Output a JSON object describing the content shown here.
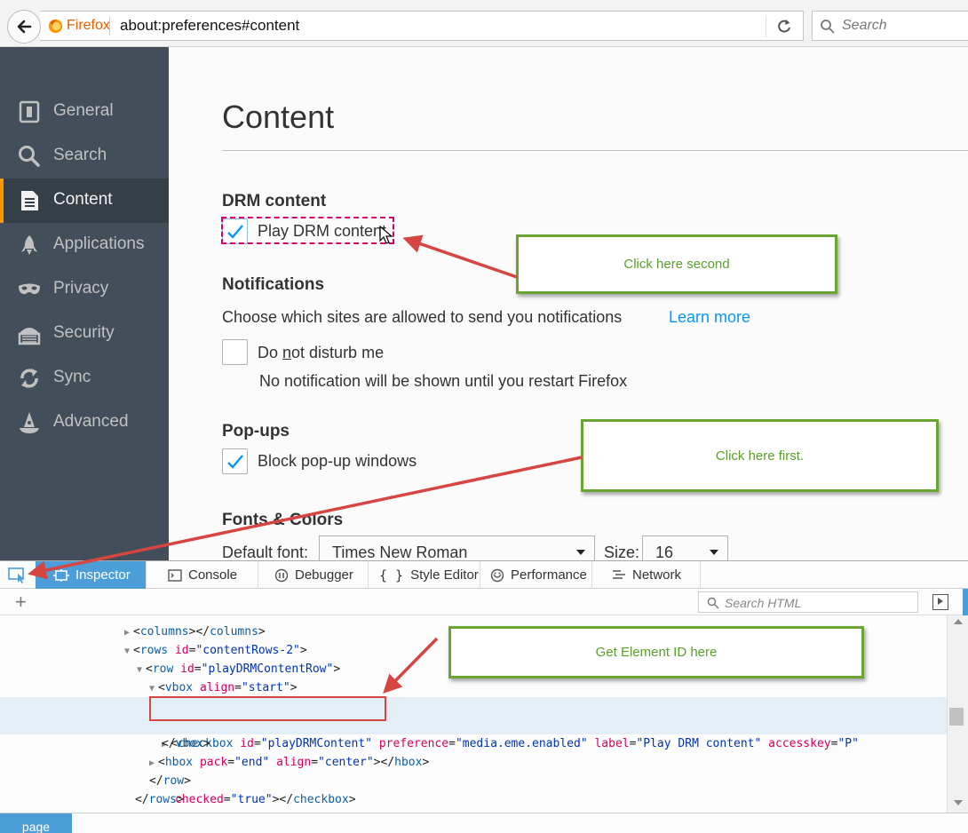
{
  "browser": {
    "brand": "Firefox",
    "url": "about:preferences#content",
    "search_placeholder": "Search"
  },
  "sidebar": {
    "items": [
      {
        "label": "General",
        "icon": "general-icon"
      },
      {
        "label": "Search",
        "icon": "search-icon"
      },
      {
        "label": "Content",
        "icon": "content-icon",
        "active": true
      },
      {
        "label": "Applications",
        "icon": "applications-icon"
      },
      {
        "label": "Privacy",
        "icon": "privacy-mask-icon"
      },
      {
        "label": "Security",
        "icon": "security-icon"
      },
      {
        "label": "Sync",
        "icon": "sync-icon"
      },
      {
        "label": "Advanced",
        "icon": "advanced-wizard-icon"
      }
    ]
  },
  "content": {
    "title": "Content",
    "drm": {
      "heading": "DRM content",
      "checkbox_label": "Play DRM content",
      "checked": true
    },
    "notifications": {
      "heading": "Notifications",
      "description": "Choose which sites are allowed to send you notifications",
      "learn_more": "Learn more",
      "dnd_label": "Do not disturb me",
      "dnd_label_parts": [
        "Do ",
        "n",
        "ot disturb me"
      ],
      "dnd_checked": false,
      "dnd_note": "No notification will be shown until you restart Firefox"
    },
    "popups": {
      "heading": "Pop-ups",
      "checkbox_label": "Block pop-up windows",
      "checked": true
    },
    "fonts": {
      "heading": "Fonts & Colors",
      "default_font_label": "Default font:",
      "default_font_value": "Times New Roman",
      "size_label": "Size:",
      "size_value": "16"
    }
  },
  "devtools": {
    "tabs": [
      {
        "label": "Inspector",
        "icon": "inspector-icon",
        "active": true
      },
      {
        "label": "Console",
        "icon": "console-icon"
      },
      {
        "label": "Debugger",
        "icon": "debugger-icon"
      },
      {
        "label": "Style Editor",
        "icon": "style-editor-braces-icon"
      },
      {
        "label": "Performance",
        "icon": "performance-icon"
      },
      {
        "label": "Network",
        "icon": "network-icon"
      }
    ],
    "add_node": "+",
    "search_placeholder": "Search HTML",
    "breadcrumb": "page",
    "markup": {
      "columns": {
        "open": "<",
        "name": "columns",
        "close": "></",
        "end": ">"
      },
      "rows": {
        "open": "<",
        "name": "rows",
        "attr": "id",
        "eq": "=",
        "value": "\"contentRows-2\"",
        "end": ">"
      },
      "row": {
        "open": "<",
        "name": "row",
        "attr": "id",
        "eq": "=",
        "value": "\"playDRMContentRow\"",
        "end": ">"
      },
      "vbox": {
        "open": "<",
        "name": "vbox",
        "attr": "align",
        "eq": "=",
        "value": "\"start\"",
        "end": ">"
      },
      "checkbox": {
        "open": "<",
        "name": "checkbox",
        "id_attr": "id",
        "id_value": "\"playDRMContent\"",
        "pref_attr": "preference",
        "pref_value": "\"media.eme.enabled\"",
        "label_attr": "label",
        "label_value": "\"Play DRM content\"",
        "key_attr": "accesskey",
        "key_value": "\"P\"",
        "checked_attr": "checked",
        "checked_value": "\"true\"",
        "eq": "=",
        "end": "></",
        "close": ">"
      },
      "vbox_close": {
        "open": "</",
        "name": "vbox",
        "end": ">"
      },
      "hbox": {
        "open": "<",
        "name": "hbox",
        "pack_attr": "pack",
        "pack_value": "\"end\"",
        "align_attr": "align",
        "align_value": "\"center\"",
        "eq": "=",
        "mid": "></",
        "end": ">"
      },
      "row_close": {
        "open": "</",
        "name": "row",
        "end": ">"
      },
      "rows_close": {
        "open": "</",
        "name": "rows",
        "end": ">"
      }
    }
  },
  "annotations": {
    "second": "Click here second",
    "first": "Click here first.",
    "element_id": "Get Element ID here"
  },
  "colors": {
    "sidebar_bg": "#424f5a",
    "sidebar_active_bg": "#343f48",
    "active_accent": "#ff9500",
    "link": "#0996f8",
    "devtools_accent": "#4c9ed9",
    "annotation_border": "#6aa534",
    "annotation_text": "#5a9e2a",
    "arrow": "#d64541"
  }
}
